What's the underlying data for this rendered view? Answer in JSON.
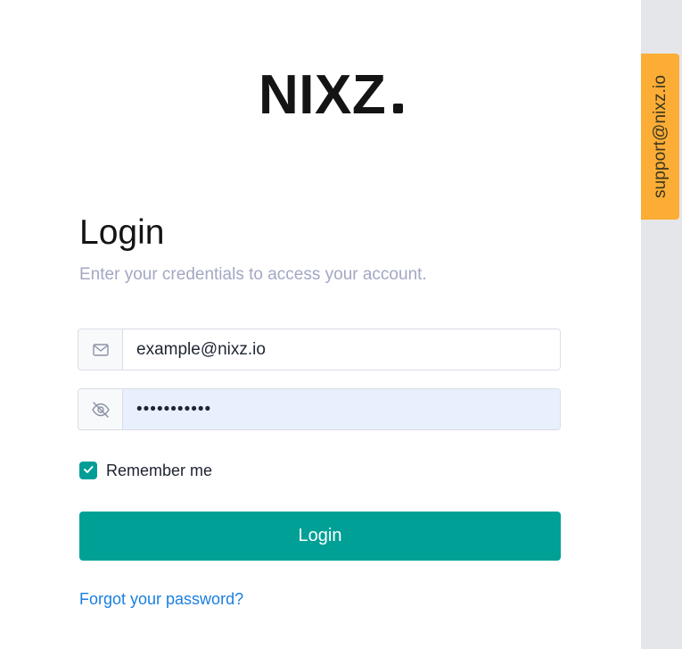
{
  "brand": {
    "name": "NIXZ"
  },
  "support": {
    "email": "support@nixz.io"
  },
  "login_form": {
    "title": "Login",
    "subtitle": "Enter your credentials to access your account.",
    "email_field": {
      "icon": "mail-icon",
      "value": "example@nixz.io"
    },
    "password_field": {
      "icon": "eye-off-icon",
      "value": "•••••••••••"
    },
    "remember_me": {
      "label": "Remember me",
      "checked": true
    },
    "submit_label": "Login",
    "forgot_link": "Forgot your password?"
  },
  "colors": {
    "accent": "#00a096",
    "support_tab": "#fbad36",
    "link": "#1a7fde",
    "subtitle": "#a3a8c3",
    "password_fill": "#e8f0fd",
    "side_panel": "#e5e6e9"
  }
}
